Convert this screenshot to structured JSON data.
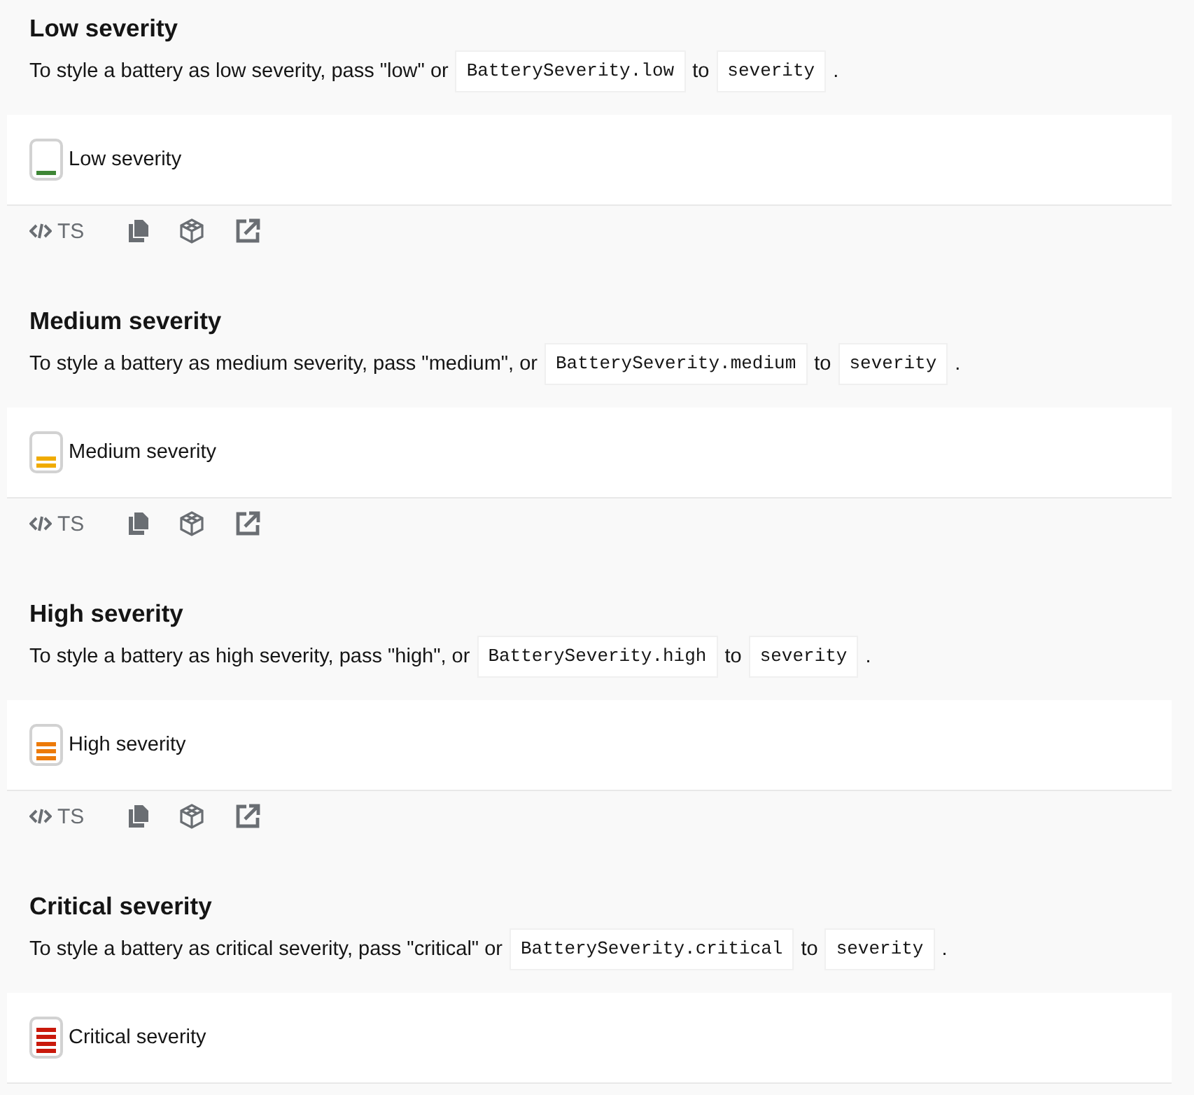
{
  "sections": [
    {
      "title": "Low severity",
      "description": [
        {
          "kind": "text",
          "text": "To style a battery as low severity, pass \"low\" or"
        },
        {
          "kind": "code",
          "text": "BatterySeverity.low"
        },
        {
          "kind": "text",
          "text": "to"
        },
        {
          "kind": "code",
          "text": "severity"
        },
        {
          "kind": "text",
          "text": "."
        }
      ],
      "example": {
        "kind": "low",
        "color": "#3e8635",
        "label": "Low severity"
      },
      "toolbar": {
        "label": "TS"
      }
    },
    {
      "title": "Medium severity",
      "description": [
        {
          "kind": "text",
          "text": "To style a battery as medium severity, pass \"medium\", or"
        },
        {
          "kind": "code",
          "text": "BatterySeverity.medium"
        },
        {
          "kind": "text",
          "text": "to"
        },
        {
          "kind": "code",
          "text": "severity"
        },
        {
          "kind": "text",
          "text": "."
        }
      ],
      "example": {
        "kind": "medium",
        "color": "#f0ab00",
        "label": "Medium severity"
      },
      "toolbar": {
        "label": "TS"
      }
    },
    {
      "title": "High severity",
      "description": [
        {
          "kind": "text",
          "text": "To style a battery as high severity, pass \"high\", or"
        },
        {
          "kind": "code",
          "text": "BatterySeverity.high"
        },
        {
          "kind": "text",
          "text": "to"
        },
        {
          "kind": "code",
          "text": "severity"
        },
        {
          "kind": "text",
          "text": "."
        }
      ],
      "example": {
        "kind": "high",
        "color": "#ec7a08",
        "label": "High severity"
      },
      "toolbar": {
        "label": "TS"
      }
    },
    {
      "title": "Critical severity",
      "description": [
        {
          "kind": "text",
          "text": "To style a battery as critical severity, pass \"critical\" or"
        },
        {
          "kind": "code",
          "text": "BatterySeverity.critical"
        },
        {
          "kind": "text",
          "text": "to"
        },
        {
          "kind": "code",
          "text": "severity"
        },
        {
          "kind": "text",
          "text": "."
        }
      ],
      "example": {
        "kind": "critical",
        "color": "#c9190b",
        "label": "Critical severity"
      }
    }
  ]
}
